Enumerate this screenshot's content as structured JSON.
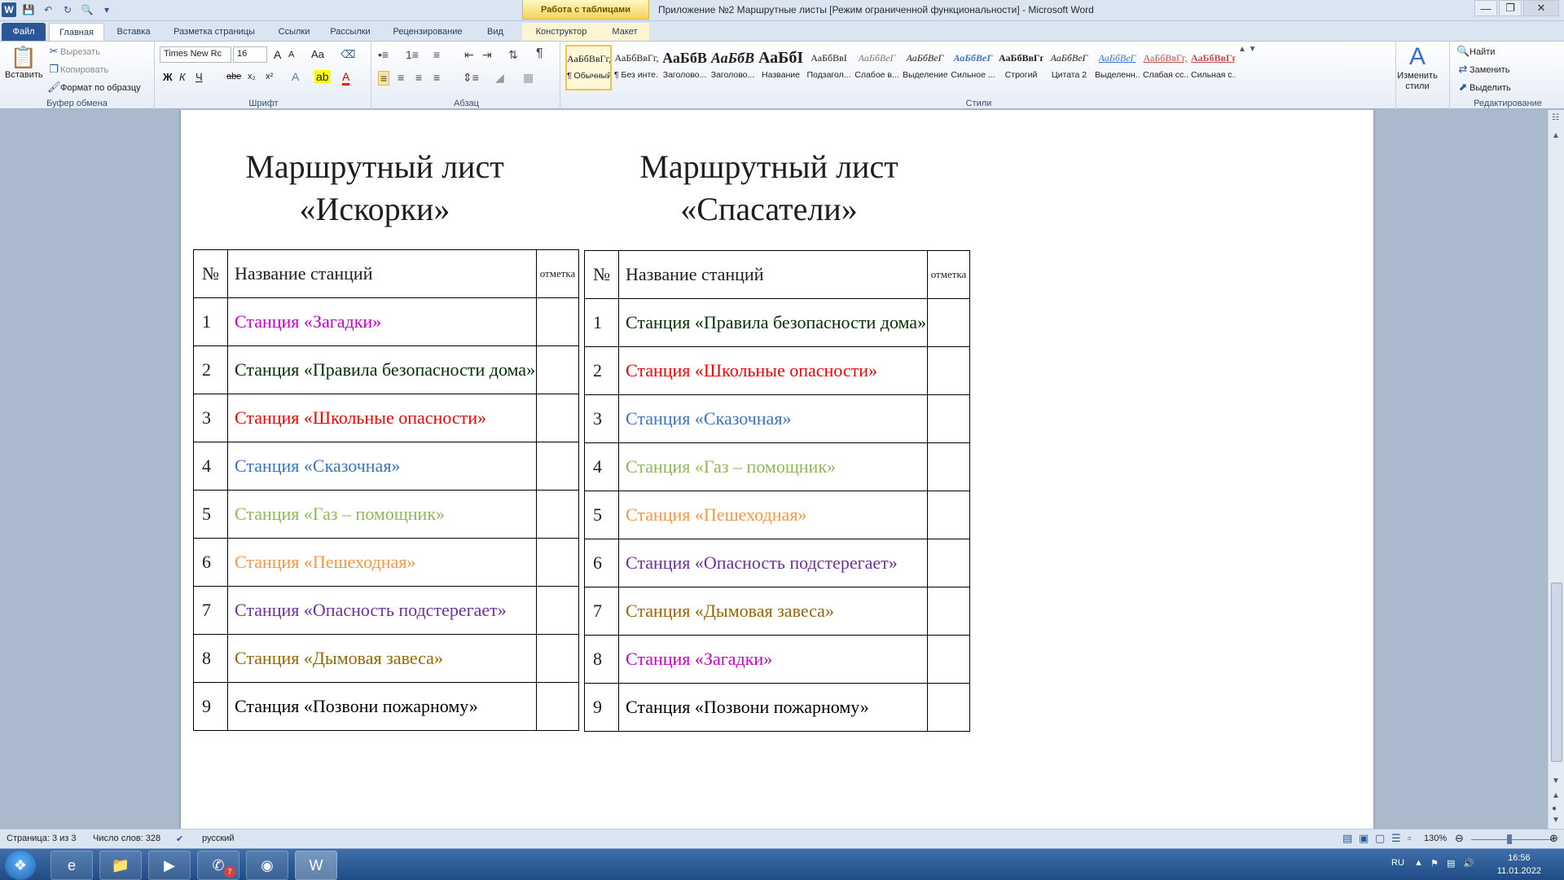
{
  "window": {
    "title": "Приложение №2 Маршрутные листы [Режим ограниченной функциональности]  -  Microsoft Word",
    "context_tab_group": "Работа с таблицами"
  },
  "tabs": [
    "Файл",
    "Главная",
    "Вставка",
    "Разметка страницы",
    "Ссылки",
    "Рассылки",
    "Рецензирование",
    "Вид",
    "Конструктор",
    "Макет"
  ],
  "ribbon": {
    "clipboard": {
      "paste": "Вставить",
      "cut": "Вырезать",
      "copy": "Копировать",
      "format_painter": "Формат по образцу",
      "label": "Буфер обмена"
    },
    "font": {
      "family": "Times New Rc",
      "size": "16",
      "label": "Шрифт",
      "bold": "Ж",
      "italic": "К",
      "underline": "Ч",
      "strike": "abe",
      "sub": "x₂",
      "sup": "x²",
      "case": "Aa",
      "grow": "A",
      "shrink": "A"
    },
    "paragraph": {
      "label": "Абзац"
    },
    "styles": {
      "label": "Стили",
      "items": [
        {
          "sample": "АаБбВвГг,",
          "name": "¶ Обычный"
        },
        {
          "sample": "АаБбВвГг,",
          "name": "¶ Без инте..."
        },
        {
          "sample": "АаБбВ",
          "name": "Заголово..."
        },
        {
          "sample": "АаБбВ",
          "name": "Заголово..."
        },
        {
          "sample": "АаБбІ",
          "name": "Название"
        },
        {
          "sample": "АаБбВвІ",
          "name": "Подзагол..."
        },
        {
          "sample": "АаБбВеГ",
          "name": "Слабое в..."
        },
        {
          "sample": "АаБбВеГ",
          "name": "Выделение"
        },
        {
          "sample": "АаБбВеГ",
          "name": "Сильное ..."
        },
        {
          "sample": "АаБбВвГг,",
          "name": "Строгий"
        },
        {
          "sample": "АаБбВеГ",
          "name": "Цитата 2"
        },
        {
          "sample": "АаБбВеГ",
          "name": "Выделенн..."
        },
        {
          "sample": "АаБбВвГг,",
          "name": "Слабая сс..."
        },
        {
          "sample": "АаБбВвГг,",
          "name": "Сильная с..."
        }
      ],
      "change_styles": "Изменить стили"
    },
    "editing": {
      "find": "Найти",
      "replace": "Заменить",
      "select": "Выделить",
      "label": "Редактирование"
    }
  },
  "document": {
    "tables": [
      {
        "title_line1": "Маршрутный лист",
        "title_line2": "«Искорки»",
        "header": {
          "num": "№",
          "name": "Название станций",
          "mark": "отметка"
        },
        "rows": [
          {
            "num": "1",
            "name": "Станция «Загадки»",
            "color": "#cc00cc"
          },
          {
            "num": "2",
            "name": "Станция «Правила безопасности дома»",
            "color": "#003300"
          },
          {
            "num": "3",
            "name": "Станция «Школьные опасности»",
            "color": "#ff0000"
          },
          {
            "num": "4",
            "name": "Станция «Сказочная»",
            "color": "#3d72c4"
          },
          {
            "num": "5",
            "name": "Станция «Газ – помощник»",
            "color": "#8fb856"
          },
          {
            "num": "6",
            "name": "Станция «Пешеходная»",
            "color": "#f79646"
          },
          {
            "num": "7",
            "name": "Станция «Опасность подстерегает»",
            "color": "#7030a0"
          },
          {
            "num": "8",
            "name": "Станция «Дымовая завеса»",
            "color": "#996600"
          },
          {
            "num": "9",
            "name": "Станция «Позвони пожарному»",
            "color": "#000000"
          }
        ]
      },
      {
        "title_line1": "Маршрутный лист",
        "title_line2": "«Спасатели»",
        "header": {
          "num": "№",
          "name": "Название станций",
          "mark": "отметка"
        },
        "rows": [
          {
            "num": "1",
            "name": "Станция «Правила безопасности дома»",
            "color": "#003300"
          },
          {
            "num": "2",
            "name": "Станция «Школьные опасности»",
            "color": "#ff0000"
          },
          {
            "num": "3",
            "name": "Станция «Сказочная»",
            "color": "#3d72c4"
          },
          {
            "num": "4",
            "name": "Станция «Газ – помощник»",
            "color": "#8fb856"
          },
          {
            "num": "5",
            "name": "Станция «Пешеходная»",
            "color": "#f79646"
          },
          {
            "num": "6",
            "name": "Станция «Опасность подстерегает»",
            "color": "#7030a0"
          },
          {
            "num": "7",
            "name": "Станция «Дымовая завеса»",
            "color": "#996600"
          },
          {
            "num": "8",
            "name": "Станция «Загадки»",
            "color": "#cc00cc"
          },
          {
            "num": "9",
            "name": "Станция «Позвони пожарному»",
            "color": "#000000"
          }
        ]
      }
    ]
  },
  "status": {
    "page": "Страница: 3 из 3",
    "words": "Число слов: 328",
    "language": "русский",
    "zoom": "130%"
  },
  "taskbar": {
    "lang": "RU",
    "time": "16:56",
    "date": "11.01.2022",
    "viber_badge": "7"
  }
}
